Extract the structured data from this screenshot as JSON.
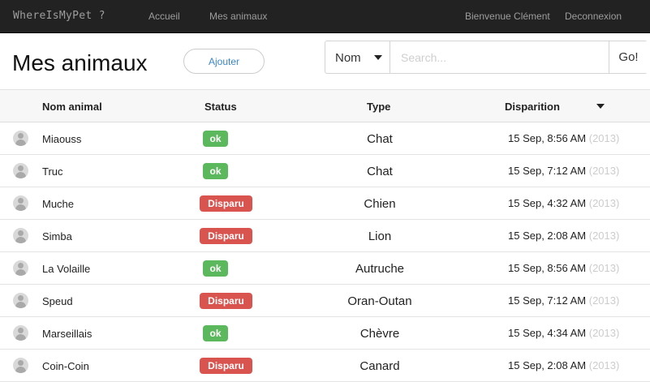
{
  "navbar": {
    "brand": "WhereIsMyPet ?",
    "links": [
      "Accueil",
      "Mes animaux"
    ],
    "welcome": "Bienvenue Clément",
    "logout": "Deconnexion"
  },
  "page": {
    "title": "Mes animaux",
    "add_label": "Ajouter"
  },
  "search": {
    "filter_value": "Nom",
    "placeholder": "Search...",
    "go_label": "Go!"
  },
  "table": {
    "headers": {
      "name": "Nom animal",
      "status": "Status",
      "type": "Type",
      "date": "Disparition"
    },
    "rows": [
      {
        "name": "Miaouss",
        "status": "ok",
        "type": "Chat",
        "date": "15 Sep, 8:56 AM",
        "year": "(2013)"
      },
      {
        "name": "Truc",
        "status": "ok",
        "type": "Chat",
        "date": "15 Sep, 7:12 AM",
        "year": "(2013)"
      },
      {
        "name": "Muche",
        "status": "Disparu",
        "type": "Chien",
        "date": "15 Sep, 4:32 AM",
        "year": "(2013)"
      },
      {
        "name": "Simba",
        "status": "Disparu",
        "type": "Lion",
        "date": "15 Sep, 2:08 AM",
        "year": "(2013)"
      },
      {
        "name": "La Volaille",
        "status": "ok",
        "type": "Autruche",
        "date": "15 Sep, 8:56 AM",
        "year": "(2013)"
      },
      {
        "name": "Speud",
        "status": "Disparu",
        "type": "Oran-Outan",
        "date": "15 Sep, 7:12 AM",
        "year": "(2013)"
      },
      {
        "name": "Marseillais",
        "status": "ok",
        "type": "Chèvre",
        "date": "15 Sep, 4:34 AM",
        "year": "(2013)"
      },
      {
        "name": "Coin-Coin",
        "status": "Disparu",
        "type": "Canard",
        "date": "15 Sep, 2:08 AM",
        "year": "(2013)"
      }
    ]
  },
  "colors": {
    "navbar_bg": "#222222",
    "status_ok": "#5cb85c",
    "status_lost": "#d9534f",
    "link_accent": "#3a87c8"
  },
  "icons": {
    "avatar": "user-avatar-icon",
    "filter_caret": "chevron-down-icon",
    "sort_caret": "sort-down-icon"
  }
}
